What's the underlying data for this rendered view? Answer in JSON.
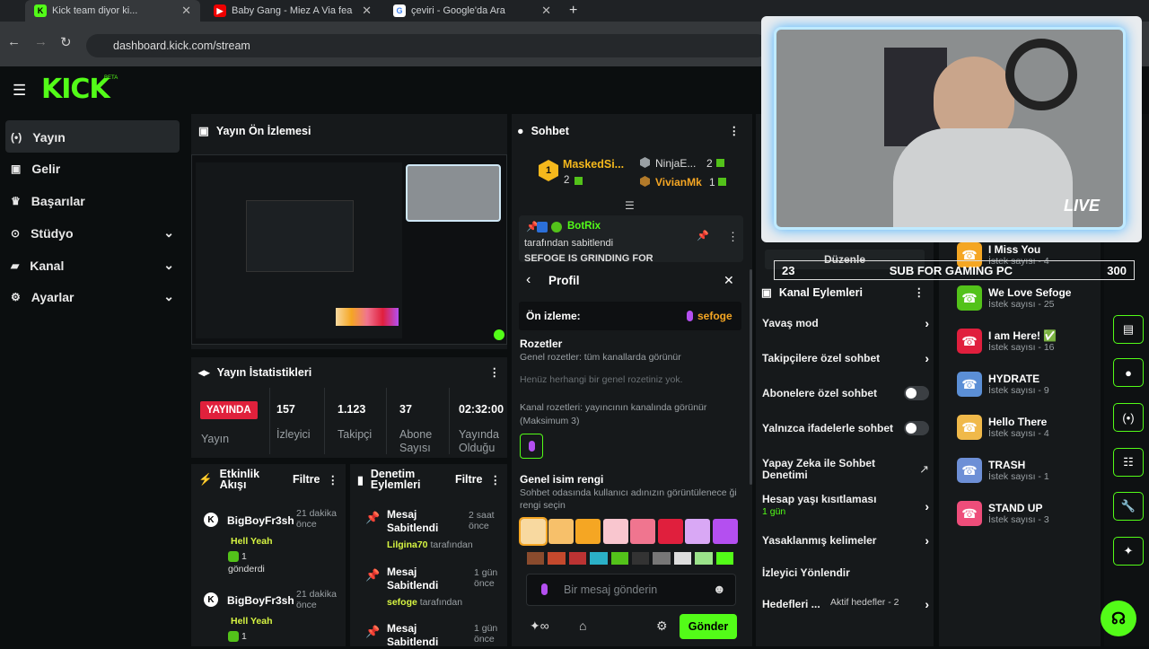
{
  "browser": {
    "tabs": [
      {
        "title": "Kick team diyor ki...",
        "active": true
      },
      {
        "title": "Baby Gang - Miez A Via fea",
        "active": false
      },
      {
        "title": "çeviri - Google'da Ara",
        "active": false
      }
    ],
    "url": "dashboard.kick.com/stream"
  },
  "brand": {
    "logo": "KICK",
    "beta": "BETA"
  },
  "nav": [
    {
      "label": "Yayın",
      "icon": "broadcast-icon",
      "active": true
    },
    {
      "label": "Gelir",
      "icon": "revenue-icon"
    },
    {
      "label": "Başarılar",
      "icon": "trophy-icon"
    },
    {
      "label": "Stüdyo",
      "icon": "studio-icon",
      "expand": true
    },
    {
      "label": "Kanal",
      "icon": "channel-icon",
      "expand": true
    },
    {
      "label": "Ayarlar",
      "icon": "gear-icon",
      "expand": true
    }
  ],
  "preview": {
    "title": "Yayın Ön İzlemesi"
  },
  "stats": {
    "title": "Yayın İstatistikleri",
    "live_badge": "YAYINDA",
    "live_label": "Yayın",
    "items": [
      {
        "value": "157",
        "label": "İzleyici"
      },
      {
        "value": "1.123",
        "label": "Takipçi"
      },
      {
        "value": "37",
        "label": "Abone Sayısı"
      },
      {
        "value": "02:32:00",
        "label": "Yayında Olduğu"
      }
    ]
  },
  "activity": {
    "title": "Etkinlik Akışı",
    "filter": "Filtre",
    "items": [
      {
        "user": "BigBoyFr3sh",
        "time": "21 dakika önce",
        "text": "Hell Yeah",
        "count": "1",
        "note": "gönderdi"
      },
      {
        "user": "BigBoyFr3sh",
        "time": "21 dakika önce",
        "text": "Hell Yeah",
        "count": "1",
        "note": ""
      }
    ]
  },
  "mod": {
    "title": "Denetim Eylemleri",
    "filter": "Filtre",
    "items": [
      {
        "title": "Mesaj Sabitlendi",
        "time": "2 saat önce",
        "by": "Lilgina70",
        "suffix": "tarafından"
      },
      {
        "title": "Mesaj Sabitlendi",
        "time": "1 gün önce",
        "by": "sefoge",
        "suffix": "tarafından"
      },
      {
        "title": "Mesaj Sabitlendi",
        "time": "1 gün önce",
        "by": "",
        "suffix": ""
      }
    ]
  },
  "chat": {
    "title": "Sohbet",
    "leaders": [
      {
        "rank": "1",
        "name": "MaskedSi...",
        "count": "2"
      },
      {
        "name": "NinjaE...",
        "count": "2"
      },
      {
        "name": "VivianMk",
        "count": "1"
      }
    ],
    "pinned": {
      "user": "BotRix",
      "by": "tarafından sabitlendi",
      "text": "SEFOGE IS GRINDING FOR"
    },
    "profile": {
      "title": "Profil",
      "preview_label": "Ön izleme:",
      "preview_name": "sefoge",
      "badges_title": "Rozetler",
      "badges_sub": "Genel rozetler: tüm kanallarda görünür",
      "badges_empty": "Henüz herhangi bir genel rozetiniz yok.",
      "channel_badges": "Kanal rozetleri: yayıncının kanalında görünür (Maksimum 3)",
      "color_title": "Genel isim rengi",
      "color_sub": "Sohbet odasında kullanıcı adınızın görüntülenece ği rengi seçin",
      "swatches": [
        "#f8d9a0",
        "#f7c06a",
        "#f5a623",
        "#f9c6cf",
        "#f0758f",
        "#e01f3d",
        "#d9a8f5",
        "#b44ff0"
      ]
    },
    "input_placeholder": "Bir mesaj gönderin",
    "send": "Gönder"
  },
  "channel_actions": {
    "title": "Kanal Eylemleri",
    "edit": "Düzenle",
    "rows": [
      {
        "label": "Yavaş mod",
        "kind": "chevron"
      },
      {
        "label": "Takipçilere özel sohbet",
        "kind": "chevron"
      },
      {
        "label": "Abonelere özel sohbet",
        "kind": "toggle"
      },
      {
        "label": "Yalnızca ifadelerle sohbet",
        "kind": "toggle"
      },
      {
        "label": "Yapay Zeka ile Sohbet Denetimi",
        "kind": "external"
      },
      {
        "label": "Hesap yaşı kısıtlaması",
        "sub": "1 gün",
        "kind": "chevron"
      },
      {
        "label": "Yasaklanmış kelimeler",
        "kind": "chevron"
      },
      {
        "label": "İzleyici Yönlendir",
        "kind": "none"
      },
      {
        "label": "Hedefleri ...",
        "sub": "Aktif hedefler - 2",
        "kind": "chevron"
      }
    ]
  },
  "requests": [
    {
      "title": "I Miss You",
      "sub": "İstek sayısı - 4",
      "color": "#f5a623"
    },
    {
      "title": "We Love Sefoge",
      "sub": "İstek sayısı - 25",
      "color": "#53c21a"
    },
    {
      "title": "I am Here! ✅",
      "sub": "İstek sayısı - 16",
      "color": "#e01f3d"
    },
    {
      "title": "HYDRATE",
      "sub": "İstek sayısı - 9",
      "color": "#5b8fd6"
    },
    {
      "title": "Hello There",
      "sub": "İstek sayısı - 4",
      "color": "#f0b94a"
    },
    {
      "title": "TRASH",
      "sub": "İstek sayısı - 1",
      "color": "#6d8fd6"
    },
    {
      "title": "STAND UP",
      "sub": "İstek sayısı - 3",
      "color": "#ee4d7a"
    }
  ],
  "overlay": {
    "live": "LIVE",
    "goal_left": "23",
    "goal_text": "SUB FOR GAMING PC",
    "goal_right": "300"
  }
}
